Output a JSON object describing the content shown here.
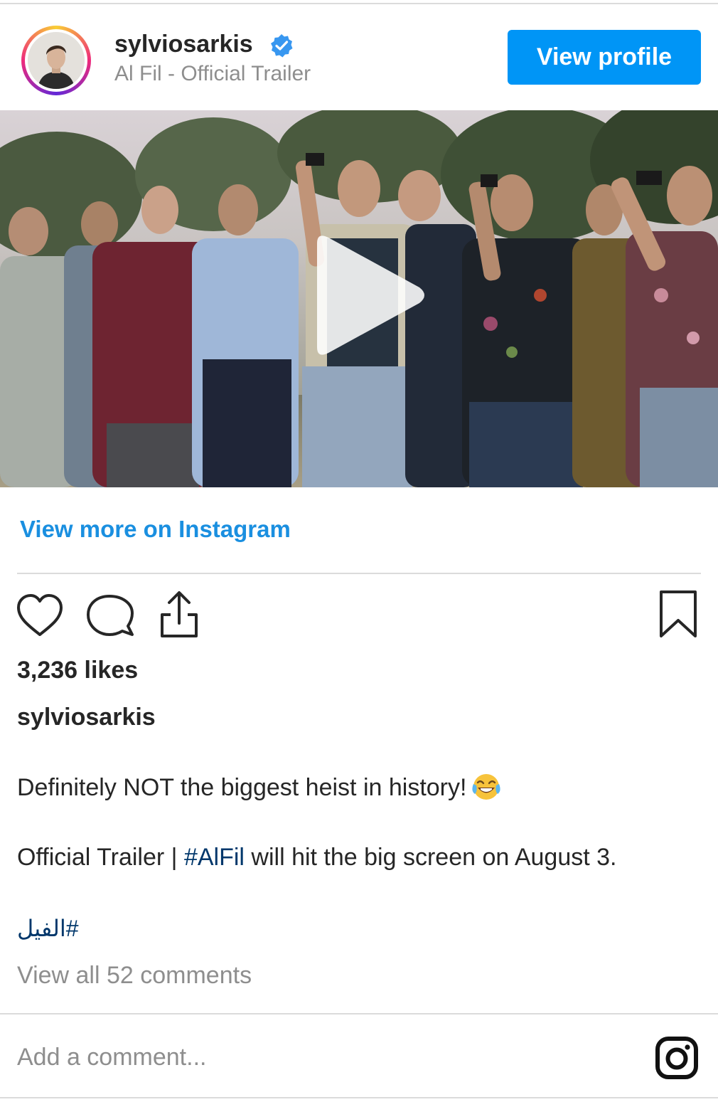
{
  "header": {
    "username": "sylviosarkis",
    "subtitle": "Al Fil - Official Trailer",
    "view_profile_label": "View profile",
    "avatar_icon": "profile-photo",
    "verified_icon": "verified-badge-icon"
  },
  "media": {
    "play_icon": "play-icon"
  },
  "view_more_label": "View more on Instagram",
  "actions": {
    "like_icon": "heart-icon",
    "comment_icon": "comment-icon",
    "share_icon": "share-icon",
    "save_icon": "bookmark-icon"
  },
  "likes_text": "3,236 likes",
  "caption": {
    "username": "sylviosarkis",
    "line1": "Definitely NOT the biggest heist in history!",
    "line1_emoji": "face-with-tears-of-joy",
    "line2_prefix": "Official Trailer | ",
    "line2_hashtag": "#AlFil",
    "line2_suffix": " will hit the big screen on August 3.",
    "arabic_hashtag": "#الفيل"
  },
  "view_comments_label": "View all 52 comments",
  "comment": {
    "placeholder": "Add a comment...",
    "instagram_icon": "instagram-icon"
  },
  "colors": {
    "accent": "#0095f6",
    "link": "#1a8fe0",
    "hashtag": "#00376b",
    "muted": "#8e8e8e"
  }
}
